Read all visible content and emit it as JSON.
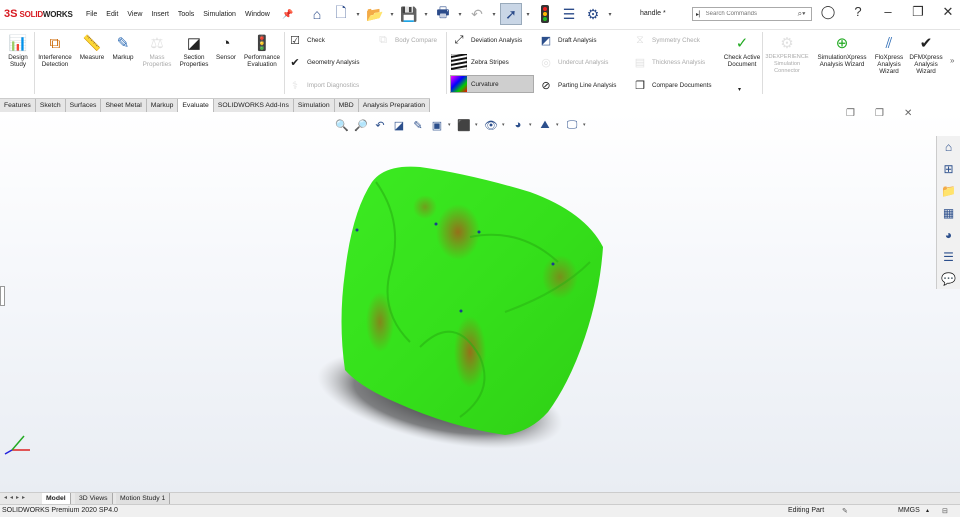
{
  "app": {
    "brand_prefix": "3S",
    "brand_solid": "SOLID",
    "brand_works": "WORKS"
  },
  "menu": [
    "File",
    "Edit",
    "View",
    "Insert",
    "Tools",
    "Simulation",
    "Window"
  ],
  "document_title": "handle *",
  "search": {
    "placeholder": "Search Commands"
  },
  "ribbon": {
    "design_study": "Design Study",
    "interference_detection": "Interference Detection",
    "measure": "Measure",
    "markup": "Markup",
    "mass_properties": "Mass Properties",
    "section_properties": "Section Properties",
    "sensor": "Sensor",
    "performance_evaluation": "Performance Evaluation",
    "check": "Check",
    "geometry_analysis": "Geometry Analysis",
    "import_diagnostics": "Import Diagnostics",
    "body_compare": "Body Compare",
    "deviation_analysis": "Deviation Analysis",
    "zebra_stripes": "Zebra Stripes",
    "curvature": "Curvature",
    "draft_analysis": "Draft Analysis",
    "undercut_analysis": "Undercut Analysis",
    "parting_line_analysis": "Parting Line Analysis",
    "symmetry_check": "Symmetry Check",
    "thickness_analysis": "Thickness Analysis",
    "compare_documents": "Compare Documents",
    "check_active_document": "Check Active Document",
    "3dexperience_connector": "3DEXPERIENCE Simulation Connector",
    "simulationxpress": "SimulationXpress Analysis Wizard",
    "floxpress": "FloXpress Analysis Wizard",
    "dfmxpress": "DFMXpress Analysis Wizard"
  },
  "tabs": [
    "Features",
    "Sketch",
    "Surfaces",
    "Sheet Metal",
    "Markup",
    "Evaluate",
    "SOLIDWORKS Add-Ins",
    "Simulation",
    "MBD",
    "Analysis Preparation"
  ],
  "active_tab": "Evaluate",
  "bottom_tabs": [
    "Model",
    "3D Views",
    "Motion Study 1"
  ],
  "status": {
    "version": "SOLIDWORKS Premium 2020 SP4.0",
    "mode": "Editing Part",
    "units": "MMGS"
  },
  "colors": {
    "curvature_high": "#9a6a1a",
    "curvature_low": "#32e11a",
    "brand": "#d71920"
  }
}
